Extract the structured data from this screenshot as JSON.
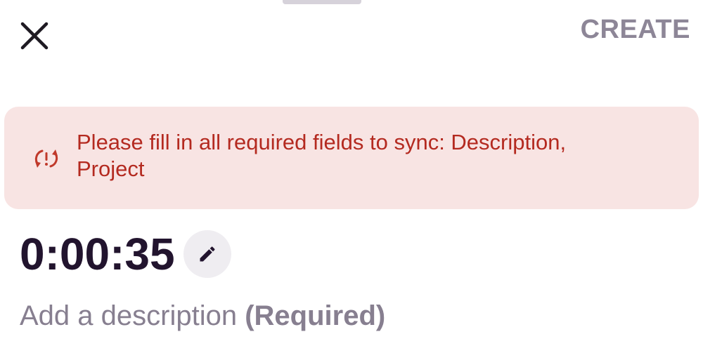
{
  "header": {
    "close_icon": "close-icon",
    "create_label": "CREATE"
  },
  "sync_banner": {
    "icon": "sync-error-icon",
    "message": "Please fill in all required fields to sync: Description, Project",
    "background_color": "#f8e4e3",
    "text_color": "#b42a20"
  },
  "timer": {
    "value": "0:00:35",
    "edit_icon": "pencil-icon"
  },
  "description": {
    "placeholder_prefix": "Add a description",
    "placeholder_required": "(Required)"
  }
}
